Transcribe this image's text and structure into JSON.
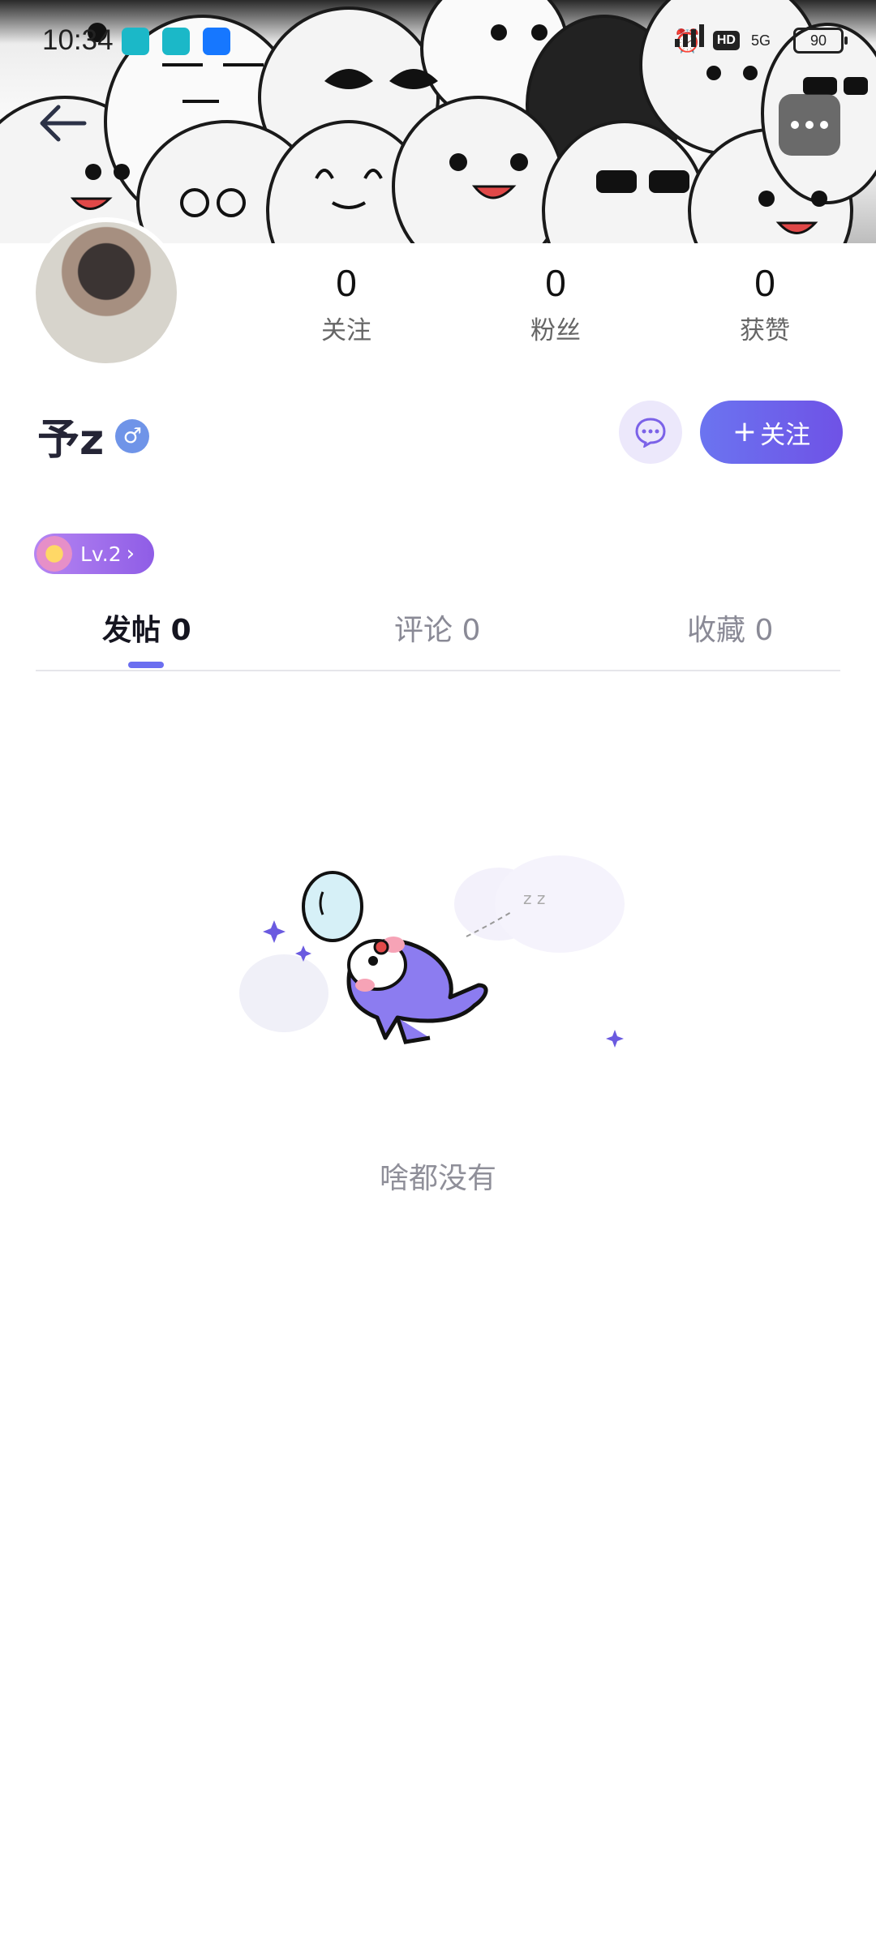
{
  "status_bar": {
    "time": "10:34",
    "network": "5G",
    "hd": "HD",
    "battery": "90"
  },
  "profile": {
    "username": "予z",
    "gender_symbol": "♂",
    "level": "Lv.2",
    "stats": [
      {
        "value": "0",
        "label": "关注"
      },
      {
        "value": "0",
        "label": "粉丝"
      },
      {
        "value": "0",
        "label": "获赞"
      }
    ]
  },
  "actions": {
    "follow_label": "关注",
    "follow_plus": "+"
  },
  "tabs": [
    {
      "label": "发帖",
      "count": "0"
    },
    {
      "label": "评论",
      "count": "0"
    },
    {
      "label": "收藏",
      "count": "0"
    }
  ],
  "empty": {
    "text": "啥都没有"
  },
  "colors": {
    "accent": "#6b6ef0",
    "level_badge": "#9b68ea",
    "gender": "#6f94e8"
  },
  "icons": {
    "back": "arrow-left-icon",
    "more": "more-dots-icon",
    "message": "chat-bubble-icon"
  }
}
